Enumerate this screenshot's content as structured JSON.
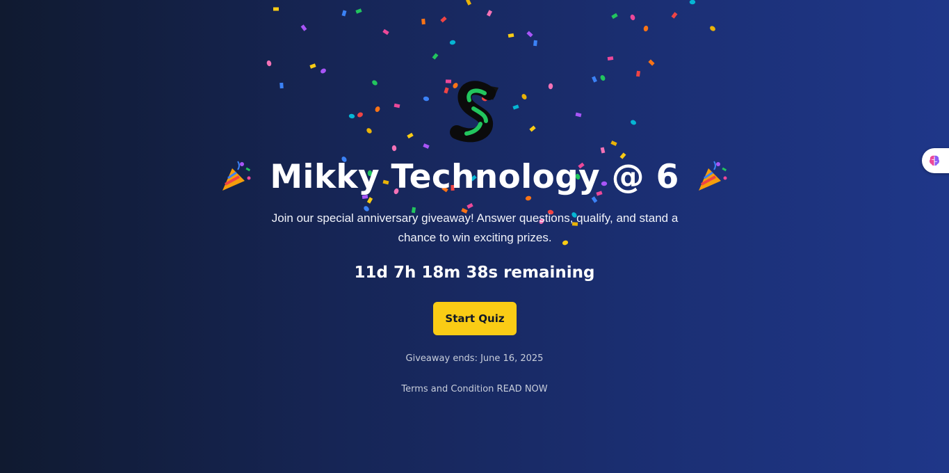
{
  "header": {
    "title": "Mikky Technology @ 6",
    "left_emoji_icon": "party-popper-icon",
    "right_emoji_icon": "party-popper-icon"
  },
  "hero": {
    "logo_icon": "mikky-s-arrow-logo",
    "subtitle": "Join our special anniversary giveaway! Answer questions, qualify, and stand a chance to win exciting prizes.",
    "countdown": "11d 7h 18m 38s remaining",
    "start_button_label": "Start Quiz",
    "giveaway_ends": "Giveaway ends: June 16, 2025",
    "terms_text": "Terms and Condition READ NOW"
  },
  "side_widget": {
    "icon": "brain-icon"
  },
  "colors": {
    "button_bg": "#facc15",
    "background_start": "#101a30",
    "background_end": "#1f3789",
    "logo_green": "#22c55e"
  }
}
